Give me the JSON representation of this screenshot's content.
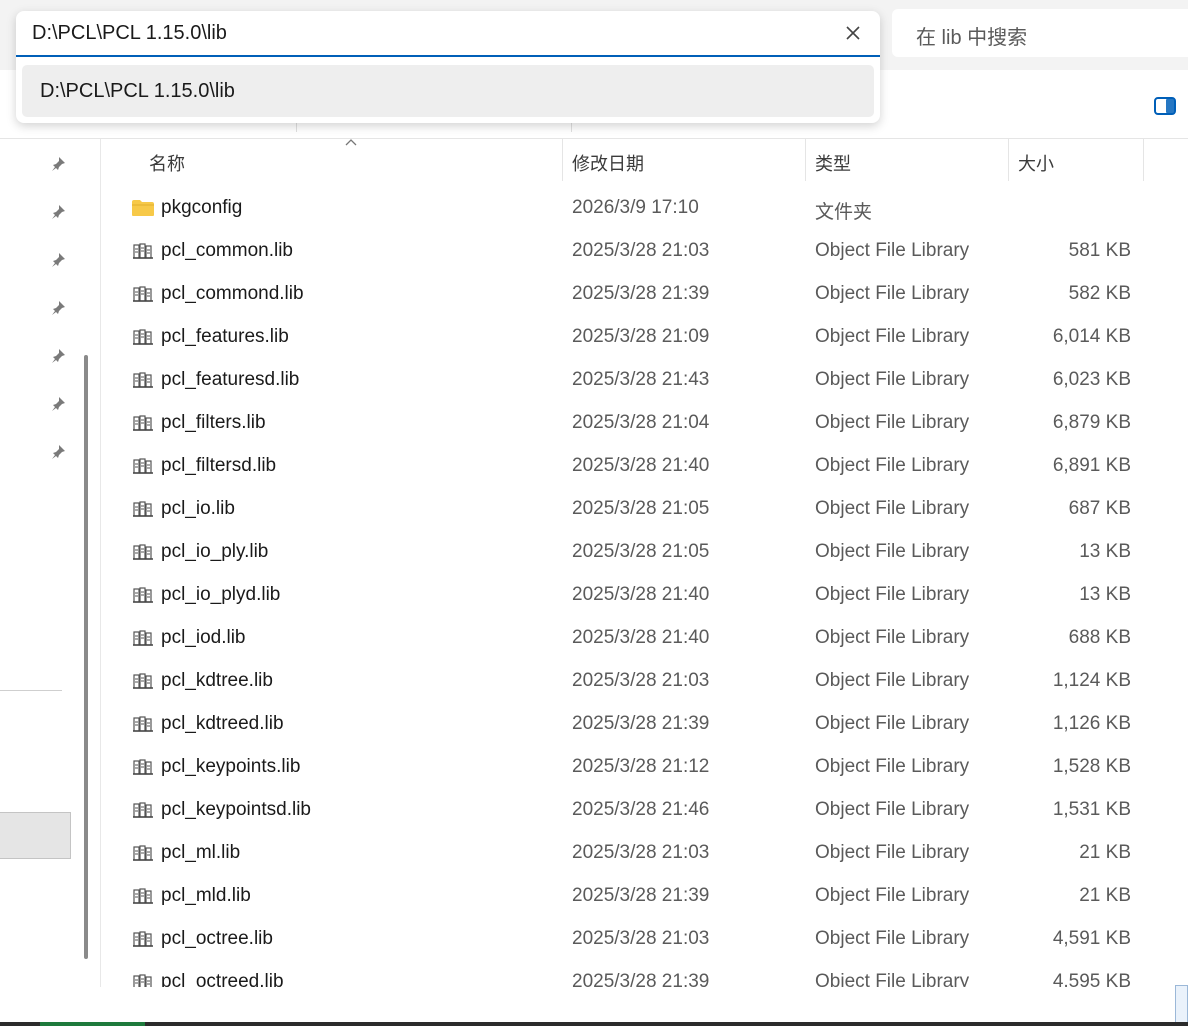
{
  "address": {
    "path": "D:\\PCL\\PCL 1.15.0\\lib",
    "suggestion": "D:\\PCL\\PCL 1.15.0\\lib"
  },
  "search": {
    "placeholder": "在 lib 中搜索"
  },
  "columns": {
    "name": "名称",
    "date": "修改日期",
    "type": "类型",
    "size": "大小"
  },
  "rows": [
    {
      "name": "pkgconfig",
      "date": "2026/3/9 17:10",
      "type": "文件夹",
      "size": "",
      "icon": "folder-icon"
    },
    {
      "name": "pcl_common.lib",
      "date": "2025/3/28 21:03",
      "type": "Object File Library",
      "size": "581 KB",
      "icon": "library-file-icon"
    },
    {
      "name": "pcl_commond.lib",
      "date": "2025/3/28 21:39",
      "type": "Object File Library",
      "size": "582 KB",
      "icon": "library-file-icon"
    },
    {
      "name": "pcl_features.lib",
      "date": "2025/3/28 21:09",
      "type": "Object File Library",
      "size": "6,014 KB",
      "icon": "library-file-icon"
    },
    {
      "name": "pcl_featuresd.lib",
      "date": "2025/3/28 21:43",
      "type": "Object File Library",
      "size": "6,023 KB",
      "icon": "library-file-icon"
    },
    {
      "name": "pcl_filters.lib",
      "date": "2025/3/28 21:04",
      "type": "Object File Library",
      "size": "6,879 KB",
      "icon": "library-file-icon"
    },
    {
      "name": "pcl_filtersd.lib",
      "date": "2025/3/28 21:40",
      "type": "Object File Library",
      "size": "6,891 KB",
      "icon": "library-file-icon"
    },
    {
      "name": "pcl_io.lib",
      "date": "2025/3/28 21:05",
      "type": "Object File Library",
      "size": "687 KB",
      "icon": "library-file-icon"
    },
    {
      "name": "pcl_io_ply.lib",
      "date": "2025/3/28 21:05",
      "type": "Object File Library",
      "size": "13 KB",
      "icon": "library-file-icon"
    },
    {
      "name": "pcl_io_plyd.lib",
      "date": "2025/3/28 21:40",
      "type": "Object File Library",
      "size": "13 KB",
      "icon": "library-file-icon"
    },
    {
      "name": "pcl_iod.lib",
      "date": "2025/3/28 21:40",
      "type": "Object File Library",
      "size": "688 KB",
      "icon": "library-file-icon"
    },
    {
      "name": "pcl_kdtree.lib",
      "date": "2025/3/28 21:03",
      "type": "Object File Library",
      "size": "1,124 KB",
      "icon": "library-file-icon"
    },
    {
      "name": "pcl_kdtreed.lib",
      "date": "2025/3/28 21:39",
      "type": "Object File Library",
      "size": "1,126 KB",
      "icon": "library-file-icon"
    },
    {
      "name": "pcl_keypoints.lib",
      "date": "2025/3/28 21:12",
      "type": "Object File Library",
      "size": "1,528 KB",
      "icon": "library-file-icon"
    },
    {
      "name": "pcl_keypointsd.lib",
      "date": "2025/3/28 21:46",
      "type": "Object File Library",
      "size": "1,531 KB",
      "icon": "library-file-icon"
    },
    {
      "name": "pcl_ml.lib",
      "date": "2025/3/28 21:03",
      "type": "Object File Library",
      "size": "21 KB",
      "icon": "library-file-icon"
    },
    {
      "name": "pcl_mld.lib",
      "date": "2025/3/28 21:39",
      "type": "Object File Library",
      "size": "21 KB",
      "icon": "library-file-icon"
    },
    {
      "name": "pcl_octree.lib",
      "date": "2025/3/28 21:03",
      "type": "Object File Library",
      "size": "4,591 KB",
      "icon": "library-file-icon"
    },
    {
      "name": "pcl_octreed.lib",
      "date": "2025/3/28 21:39",
      "type": "Object File Library",
      "size": "4,595 KB",
      "icon": "library-file-icon"
    }
  ],
  "colors": {
    "accent": "#005fb8",
    "folder": "#f7c948"
  }
}
